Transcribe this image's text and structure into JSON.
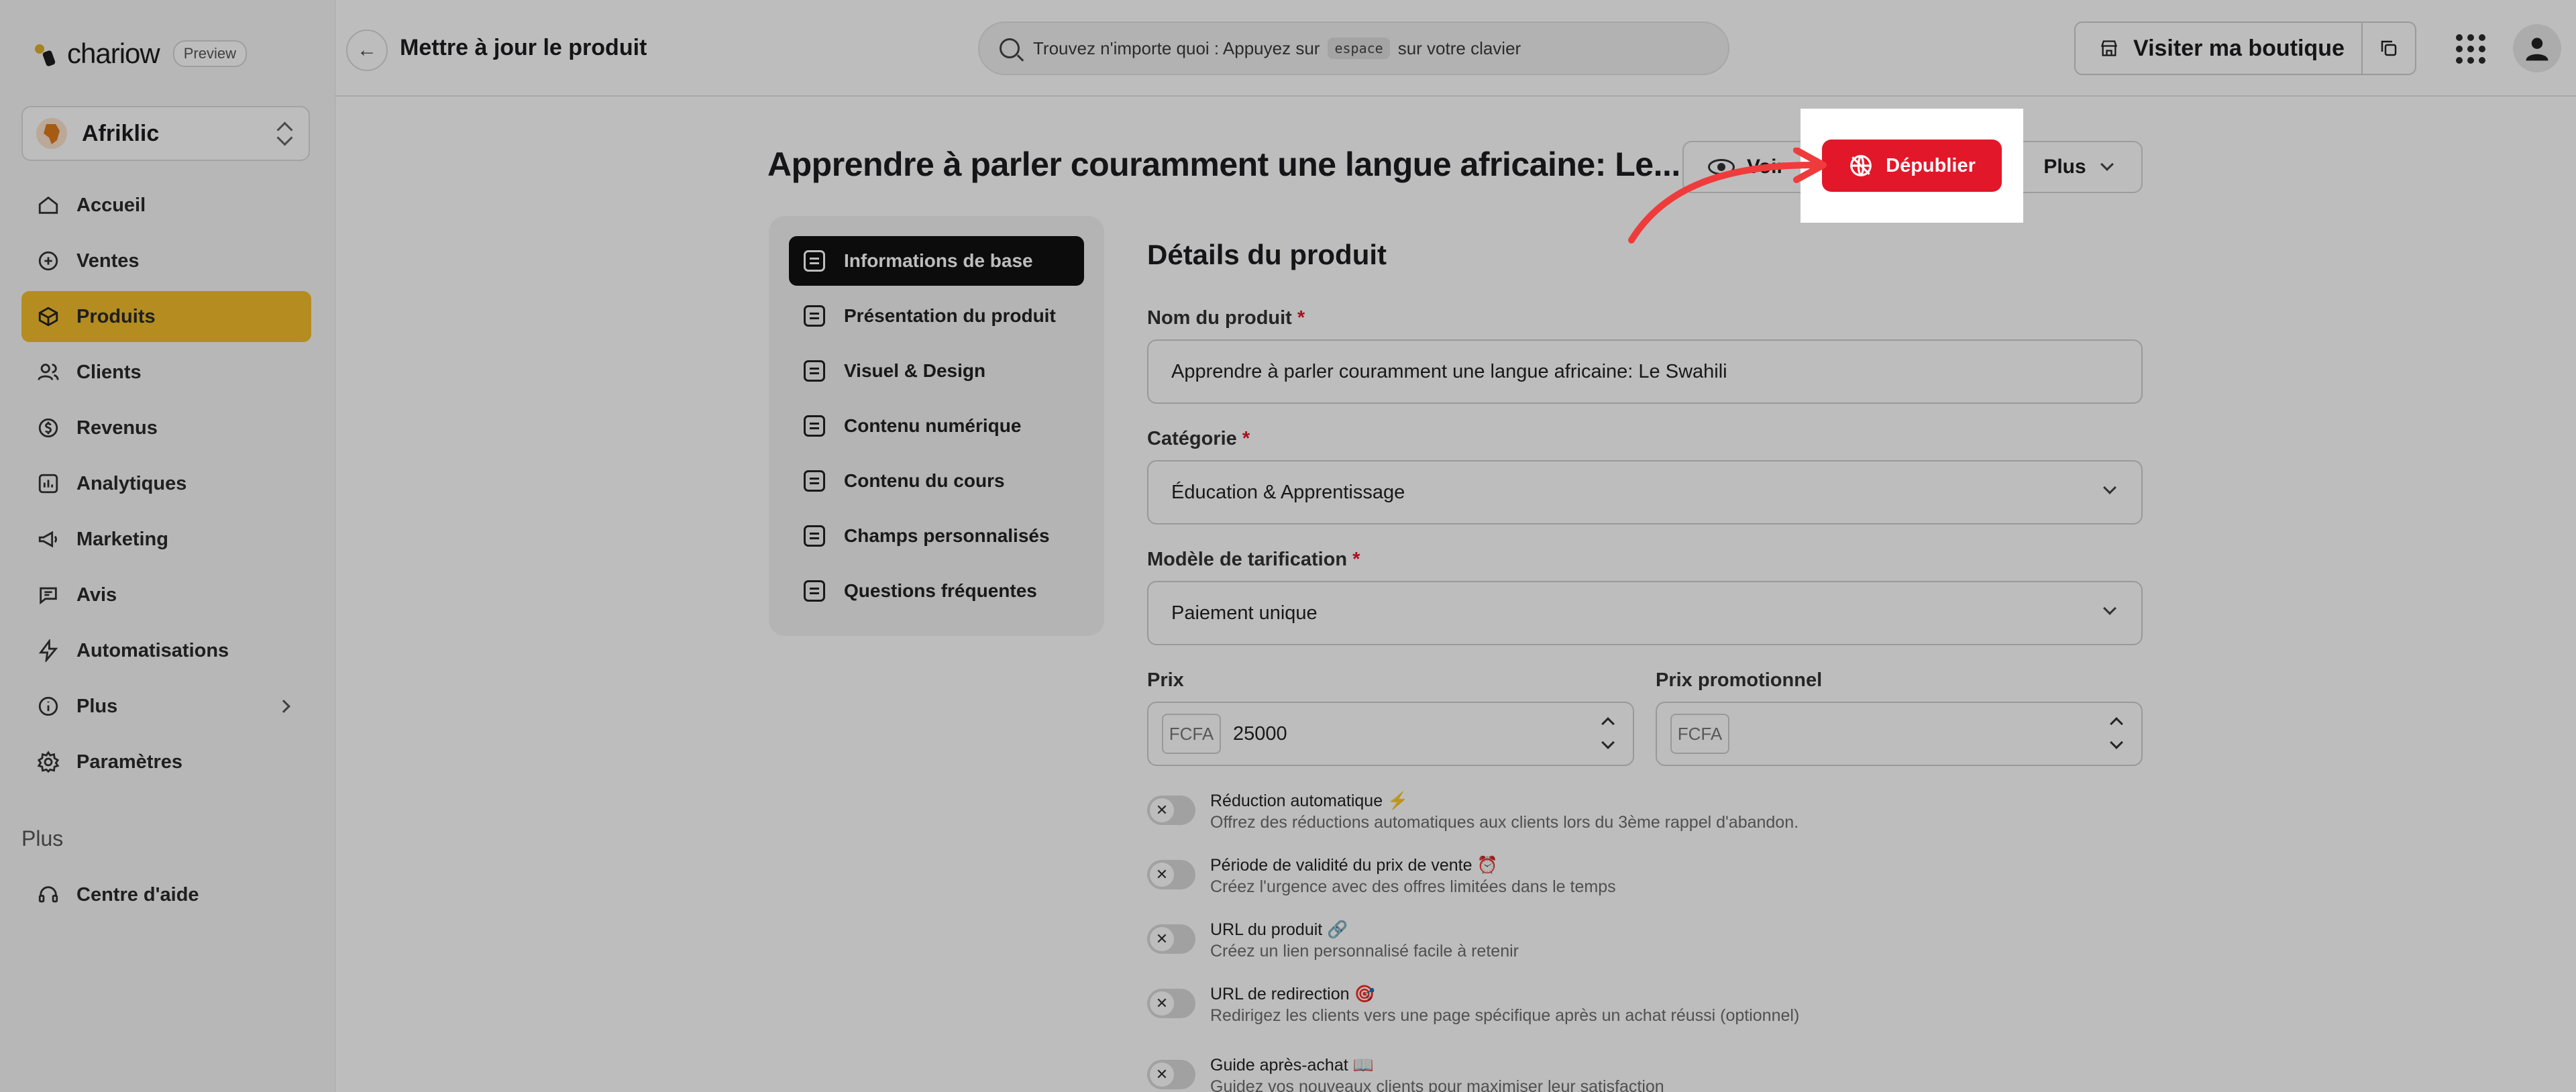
{
  "brand": {
    "name": "chariow",
    "badge": "Preview"
  },
  "shop": {
    "name": "Afriklic",
    "avatar_text": "Afriklic"
  },
  "sidebar": {
    "items": [
      {
        "label": "Accueil",
        "icon": "home-icon"
      },
      {
        "label": "Ventes",
        "icon": "sales-icon"
      },
      {
        "label": "Produits",
        "icon": "box-icon",
        "active": true
      },
      {
        "label": "Clients",
        "icon": "users-icon"
      },
      {
        "label": "Revenus",
        "icon": "dollar-icon"
      },
      {
        "label": "Analytiques",
        "icon": "chart-icon"
      },
      {
        "label": "Marketing",
        "icon": "megaphone-icon"
      },
      {
        "label": "Avis",
        "icon": "chat-icon"
      },
      {
        "label": "Automatisations",
        "icon": "bolt-icon"
      },
      {
        "label": "Plus",
        "icon": "info-icon"
      },
      {
        "label": "Paramètres",
        "icon": "gear-icon"
      }
    ],
    "section_title": "Plus",
    "help": {
      "label": "Centre d'aide",
      "icon": "headset-icon"
    }
  },
  "topbar": {
    "title": "Mettre à jour le produit",
    "search_before": "Trouvez n'importe quoi : Appuyez sur",
    "search_key": "espace",
    "search_after": "sur votre clavier",
    "visit_label": "Visiter ma boutique"
  },
  "product": {
    "title": "Apprendre à parler couramment une langue africaine: Le...",
    "view_label": "Voir",
    "unpublish_label": "Dépublier",
    "more_label": "Plus"
  },
  "tabs": [
    {
      "label": "Informations de base",
      "active": true
    },
    {
      "label": "Présentation du produit"
    },
    {
      "label": "Visuel & Design"
    },
    {
      "label": "Contenu numérique"
    },
    {
      "label": "Contenu du cours"
    },
    {
      "label": "Champs personnalisés"
    },
    {
      "label": "Questions fréquentes"
    }
  ],
  "form": {
    "section_title": "Détails du produit",
    "name_label": "Nom du produit",
    "name_value": "Apprendre à parler couramment une langue africaine: Le Swahili",
    "category_label": "Catégorie",
    "category_value": "Éducation & Apprentissage",
    "pricing_label": "Modèle de tarification",
    "pricing_value": "Paiement unique",
    "price_label": "Prix",
    "price_currency": "FCFA",
    "price_value": "25000",
    "promo_label": "Prix promotionnel",
    "promo_currency": "FCFA",
    "required_mark": "*"
  },
  "toggles": [
    {
      "title": "Réduction automatique ⚡",
      "desc": "Offrez des réductions automatiques aux clients lors du 3ème rappel d'abandon."
    },
    {
      "title": "Période de validité du prix de vente ⏰",
      "desc": "Créez l'urgence avec des offres limitées dans le temps"
    },
    {
      "title": "URL du produit 🔗",
      "desc": "Créez un lien personnalisé facile à retenir"
    },
    {
      "title": "URL de redirection 🎯",
      "desc": "Redirigez les clients vers une page spécifique après un achat réussi (optionnel)"
    },
    {
      "title": "Guide après-achat 📖",
      "desc": "Guidez vos nouveaux clients pour maximiser leur satisfaction"
    }
  ],
  "colors": {
    "accent": "#f3bd2c",
    "danger": "#e2172a",
    "dark": "#111111"
  }
}
